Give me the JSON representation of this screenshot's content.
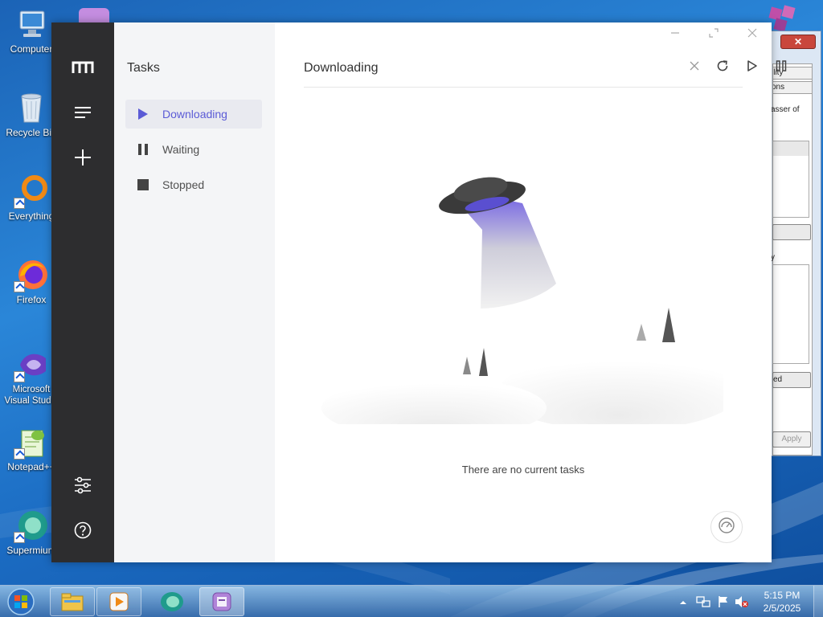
{
  "desktop": {
    "icons": [
      {
        "label": "Computer",
        "icon": "computer-icon"
      },
      {
        "label": "Recycle Bin",
        "icon": "recycle-bin-icon"
      },
      {
        "label": "Everything",
        "icon": "everything-icon"
      },
      {
        "label": "Firefox",
        "icon": "firefox-icon"
      },
      {
        "label": "Microsoft Visual Studio",
        "icon": "visual-studio-icon"
      },
      {
        "label": "Notepad++",
        "icon": "notepad-plus-plus-icon"
      },
      {
        "label": "Supermium",
        "icon": "supermium-icon"
      }
    ]
  },
  "background_dialog": {
    "close_label": "✕",
    "tabs": [
      "ility",
      "ons"
    ],
    "text_line": "asser of",
    "text_line2": "y",
    "button1_label": "",
    "button2_label": "ed",
    "apply_label": "Apply"
  },
  "app": {
    "rail": {
      "logo_icon": "motrix-logo-icon",
      "menu_icon": "menu-icon",
      "add_icon": "plus-icon",
      "settings_icon": "sliders-icon",
      "help_icon": "help-icon"
    },
    "sidebar": {
      "title": "Tasks",
      "items": [
        {
          "label": "Downloading",
          "icon": "play-icon",
          "active": true
        },
        {
          "label": "Waiting",
          "icon": "pause-icon",
          "active": false
        },
        {
          "label": "Stopped",
          "icon": "stop-icon",
          "active": false
        }
      ]
    },
    "main": {
      "title": "Downloading",
      "toolbar": [
        "close-icon",
        "refresh-icon",
        "play-icon",
        "pause-icon"
      ],
      "empty_message": "There are no current tasks",
      "speed_icon": "speedometer-icon"
    },
    "window_controls": [
      "minimize-icon",
      "maximize-icon",
      "close-icon"
    ],
    "colors": {
      "accent": "#5b5bd6",
      "rail": "#2d2d2f",
      "sidebar": "#f4f5f7"
    }
  },
  "taskbar": {
    "time": "5:15 PM",
    "date": "2/5/2025",
    "buttons": [
      "explorer-icon",
      "media-player-icon",
      "supermium-icon",
      "motrix-icon"
    ]
  }
}
